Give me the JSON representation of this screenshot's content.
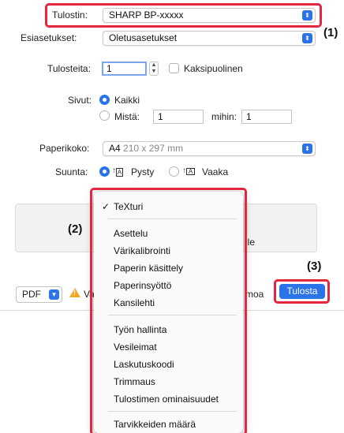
{
  "callouts": [
    "(1)",
    "(2)",
    "(3)"
  ],
  "printer": {
    "label": "Tulostin:",
    "value": "SHARP BP-xxxxx"
  },
  "presets": {
    "label": "Esiasetukset:",
    "value": "Oletusasetukset"
  },
  "copies": {
    "label": "Tulosteita:",
    "value": "1",
    "duplex_label": "Kaksipuolinen",
    "duplex_checked": false
  },
  "pages": {
    "label": "Sivut:",
    "all_label": "Kaikki",
    "all_selected": true,
    "range_label": "Mistä:",
    "from_value": "1",
    "to_label": "mihin:",
    "to_value": "1"
  },
  "paper": {
    "label": "Paperikoko:",
    "size": "A4",
    "dims": "210 x 297 mm"
  },
  "orientation": {
    "label": "Suunta:",
    "portrait": "Pysty",
    "landscape": "Vaaka",
    "selected": "portrait"
  },
  "panel": {
    "partial_text": "lle"
  },
  "footer": {
    "pdf_label": "PDF",
    "warning_partial": "Va",
    "cancel_partial": "moa",
    "print_label": "Tulosta"
  },
  "menu": {
    "selected": "TeXturi",
    "group1": [
      "Asettelu",
      "Värikalibrointi",
      "Paperin käsittely",
      "Paperinsyöttö",
      "Kansilehti"
    ],
    "group2": [
      "Työn hallinta",
      "Vesileimat",
      "Laskutuskoodi",
      "Trimmaus",
      "Tulostimen ominaisuudet"
    ],
    "group3": [
      "Tarvikkeiden määrä"
    ]
  },
  "colors": {
    "accent": "#2a73e8",
    "highlight_frame": "#e5263f",
    "warning": "#f3a628"
  },
  "icons": [
    "popup-chevron-icon",
    "stepper-icon",
    "portrait-icon",
    "landscape-icon",
    "warning-icon",
    "checkmark-icon"
  ]
}
